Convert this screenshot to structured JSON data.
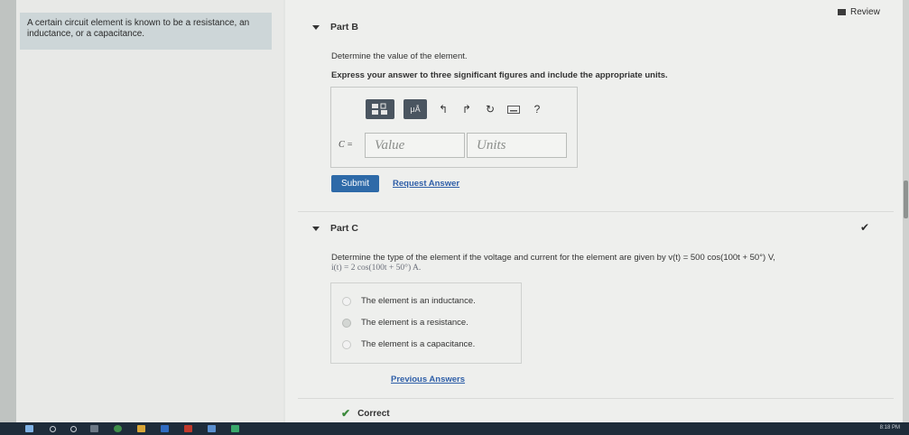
{
  "sidebar": {
    "description": "A certain circuit element is known to be a resistance, an inductance, or a capacitance."
  },
  "header": {
    "review_label": "Review"
  },
  "part_b": {
    "title": "Part B",
    "prompt": "Determine the value of the element.",
    "instruction": "Express your answer to three significant figures and include the appropriate units.",
    "toolbar": {
      "templates_icon": "templates-icon",
      "units_label": "μÅ",
      "help_label": "?"
    },
    "variable_label": "C =",
    "value_placeholder": "Value",
    "units_placeholder": "Units",
    "submit_label": "Submit",
    "request_answer_label": "Request Answer"
  },
  "part_c": {
    "title": "Part C",
    "question_line1": "Determine the type of the element if the voltage and current for the element are given by v(t) = 500 cos(100t + 50°) V,",
    "question_line2": "i(t) = 2 cos(100t + 50°) A.",
    "options": [
      {
        "label": "The element is an inductance."
      },
      {
        "label": "The element is a resistance.",
        "selected": true
      },
      {
        "label": "The element is a capacitance."
      }
    ],
    "previous_answers_label": "Previous Answers",
    "result_label": "Correct"
  },
  "taskbar": {
    "clock": "8:18 PM"
  },
  "colors": {
    "accent": "#2e6aa8",
    "link": "#2f5fa8",
    "correct": "#3c8a3c",
    "taskbar": "#1e2c3a"
  }
}
